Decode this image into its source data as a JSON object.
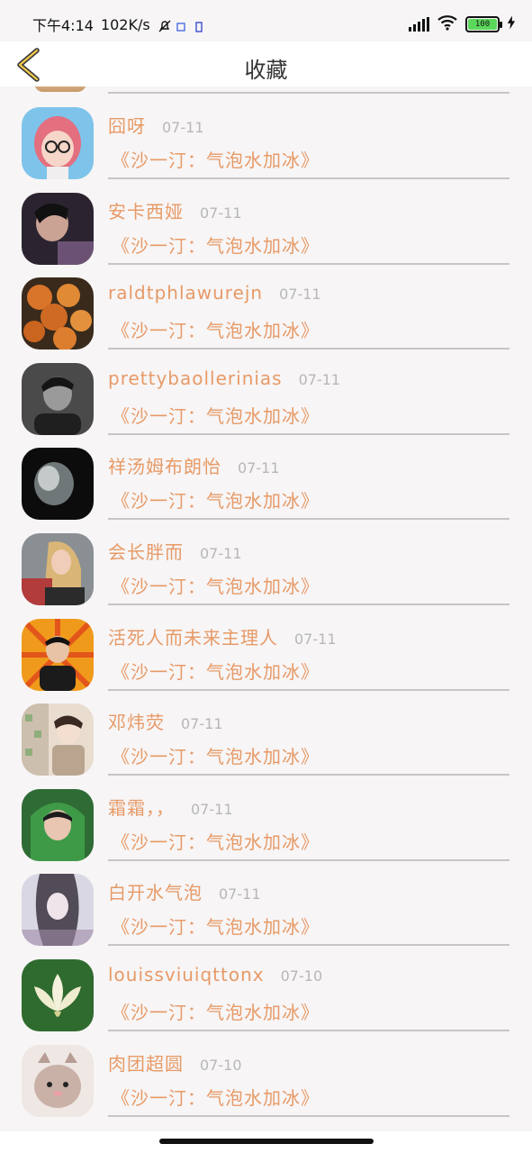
{
  "status_bar": {
    "time": "下午4:14",
    "network_speed": "102K/s",
    "battery": "100",
    "icons": [
      "mute-icon",
      "app-notification-icon",
      "sim-icon",
      "signal-icon",
      "wifi-icon",
      "battery-icon",
      "charging-icon"
    ]
  },
  "header": {
    "title": "收藏",
    "back_icon": "chevron-left-icon"
  },
  "accent_color": "#e79a67",
  "date_color": "#b7b7b7",
  "items": [
    {
      "name": "囧呀",
      "date": "07-11",
      "subtitle": "《沙一汀：气泡水加冰》"
    },
    {
      "name": "安卡西娅",
      "date": "07-11",
      "subtitle": "《沙一汀：气泡水加冰》"
    },
    {
      "name": "raldtphlawurejn",
      "date": "07-11",
      "subtitle": "《沙一汀：气泡水加冰》"
    },
    {
      "name": "prettybaollerinias",
      "date": "07-11",
      "subtitle": "《沙一汀：气泡水加冰》"
    },
    {
      "name": "祥汤姆布朗怡",
      "date": "07-11",
      "subtitle": "《沙一汀：气泡水加冰》"
    },
    {
      "name": "会长胖而",
      "date": "07-11",
      "subtitle": "《沙一汀：气泡水加冰》"
    },
    {
      "name": "活死人而未来主理人",
      "date": "07-11",
      "subtitle": "《沙一汀：气泡水加冰》"
    },
    {
      "name": "邓炜荧",
      "date": "07-11",
      "subtitle": "《沙一汀：气泡水加冰》"
    },
    {
      "name": "霜霜，，",
      "date": "07-11",
      "subtitle": "《沙一汀：气泡水加冰》"
    },
    {
      "name": "白开水气泡",
      "date": "07-11",
      "subtitle": "《沙一汀：气泡水加冰》"
    },
    {
      "name": "louissviuiqttonx",
      "date": "07-10",
      "subtitle": "《沙一汀：气泡水加冰》"
    },
    {
      "name": "肉团超圆",
      "date": "07-10",
      "subtitle": "《沙一汀：气泡水加冰》"
    }
  ]
}
